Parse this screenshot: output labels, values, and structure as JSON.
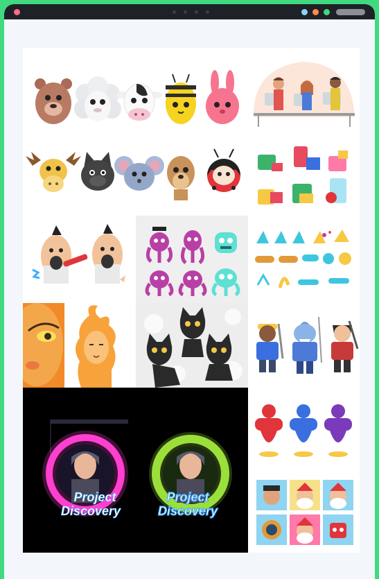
{
  "window": {
    "controls": [
      "close-dot",
      "window-dot-blue",
      "window-dot-orange",
      "window-dot-green"
    ],
    "accent": "#3fd97f"
  },
  "gallery": {
    "tiles": [
      {
        "id": "animal-faces-top",
        "icons": [
          "bear-icon",
          "sheep-icon",
          "cow-icon",
          "bee-icon",
          "bunny-icon"
        ]
      },
      {
        "id": "team-at-computers",
        "icons": [
          "team-illustration-icon"
        ]
      },
      {
        "id": "animal-faces-bottom",
        "icons": [
          "moose-icon",
          "cat-icon",
          "mouse-icon",
          "meerkat-icon",
          "ladybug-icon"
        ]
      },
      {
        "id": "cube-characters",
        "icons": [
          "cube-character-icon"
        ]
      },
      {
        "id": "punk-egg-characters",
        "icons": [
          "punk-egg-icon"
        ]
      },
      {
        "id": "octopus-characters",
        "icons": [
          "octopus-icon"
        ]
      },
      {
        "id": "dragon-sticker-set",
        "icons": [
          "dragon-sticker-icon"
        ]
      },
      {
        "id": "fire-woman-portrait",
        "icons": [
          "fire-woman-icon"
        ]
      },
      {
        "id": "black-cats",
        "icons": [
          "black-cat-icon"
        ]
      },
      {
        "id": "toy-figures",
        "icons": [
          "miner-icon",
          "shark-icon",
          "ninja-icon"
        ]
      },
      {
        "id": "genie-characters",
        "icons": [
          "genie-icon"
        ]
      },
      {
        "id": "project-discovery",
        "icons": [
          "pink-portal-icon",
          "green-portal-icon"
        ]
      },
      {
        "id": "holiday-avatars",
        "icons": [
          "pirate-icon",
          "santa-icon",
          "diver-icon",
          "robot-santa-icon"
        ]
      }
    ],
    "project_discovery": {
      "line1": "Project",
      "line2": "Discovery",
      "pink": "#ff3fd0",
      "green": "#9be03a",
      "text_blue": "#3fa8ff"
    }
  }
}
